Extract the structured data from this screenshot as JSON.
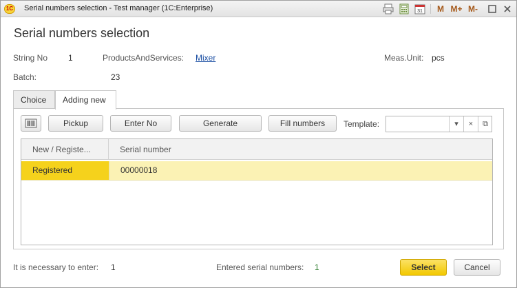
{
  "window": {
    "title": "Serial numbers selection  - Test manager (1C:Enterprise)",
    "logo_text": "1С",
    "m_label": "M",
    "m_plus_label": "M+",
    "m_minus_label": "M-",
    "calendar_day": "31"
  },
  "form": {
    "title": "Serial numbers selection"
  },
  "fields": {
    "string_no_label": "String No",
    "string_no_value": "1",
    "products_label": "ProductsAndServices:",
    "products_value": "Mixer",
    "meas_unit_label": "Meas.Unit:",
    "meas_unit_value": "pcs",
    "batch_label": "Batch:",
    "batch_value": "23"
  },
  "tabs": [
    {
      "label": "Choice"
    },
    {
      "label": "Adding new"
    }
  ],
  "toolbar": {
    "pickup_label": "Pickup",
    "enter_no_label": "Enter No",
    "generate_label": "Generate",
    "fill_numbers_label": "Fill numbers",
    "template_label": "Template:",
    "template_value": ""
  },
  "table": {
    "columns": [
      "New / Registe...",
      "Serial number"
    ],
    "rows": [
      {
        "status": "Registered",
        "serial": "00000018"
      }
    ]
  },
  "footer": {
    "need_label": "It is necessary to enter:",
    "need_value": "1",
    "entered_label": "Entered serial numbers:",
    "entered_value": "1",
    "select_label": "Select",
    "cancel_label": "Cancel"
  }
}
